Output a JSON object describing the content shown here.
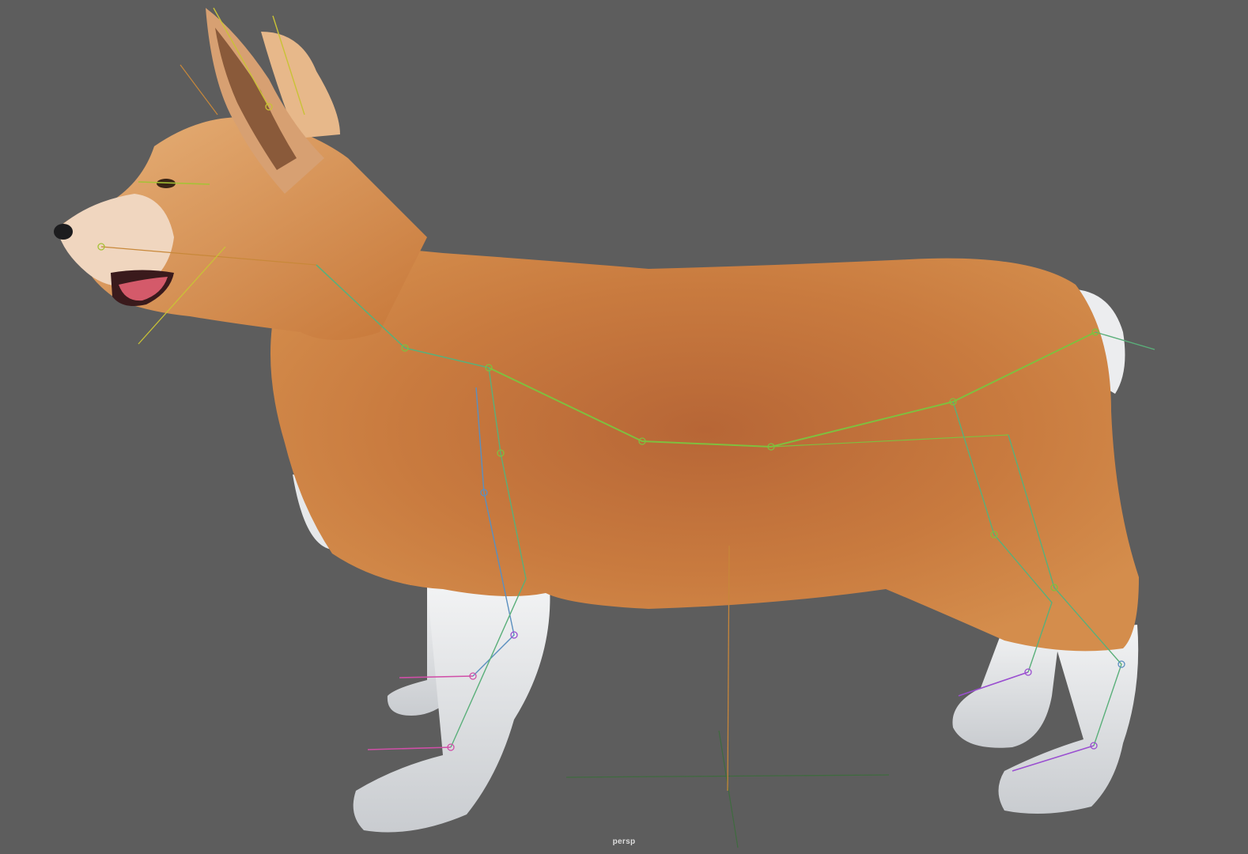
{
  "viewport": {
    "camera_name": "persp",
    "background_color": "#5d5d5d"
  },
  "model": {
    "subject": "corgi",
    "fur_color": "#c8783c",
    "white_fur_color": "#e6e8ea"
  },
  "skeleton": {
    "spine_color": "#7fbf3f",
    "leg_color": "#5aaf7a",
    "foot_color": "#9a4fd0",
    "toe_color": "#d04fa8",
    "head_color": "#c9c236"
  },
  "grid": {
    "axis_color": "#3f6b3f",
    "vertical_axis_color": "#c7863a"
  }
}
